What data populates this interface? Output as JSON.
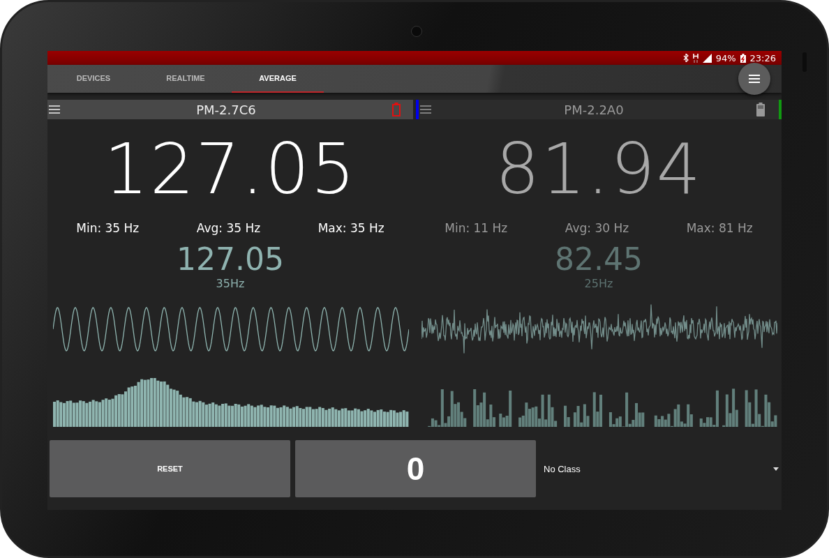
{
  "status_bar": {
    "battery": "94%",
    "time": "23:26"
  },
  "tabs": [
    {
      "label": "DEVICES",
      "selected": false
    },
    {
      "label": "REALTIME",
      "selected": false
    },
    {
      "label": "AVERAGE",
      "selected": true
    }
  ],
  "devices": [
    {
      "name": "PM-2.7C6",
      "battery_low": true,
      "active": true,
      "value": "127.05",
      "stats": [
        "Min: 35 Hz",
        "Avg: 35 Hz",
        "Max: 35 Hz"
      ],
      "peak_value": "127.05",
      "peak_freq": "35Hz",
      "waveform": {
        "kind": "sine"
      },
      "spectrum": {
        "kind": "peak"
      }
    },
    {
      "name": "PM-2.2A0",
      "battery_low": false,
      "active": false,
      "color": "#0000ee",
      "status": {
        "color": "#119911"
      },
      "value": "81.94",
      "stats": [
        "Min: 11 Hz",
        "Avg: 30 Hz",
        "Max: 81 Hz"
      ],
      "peak_value": "82.45",
      "peak_freq": "25Hz",
      "waveform": {
        "kind": "noise"
      },
      "spectrum": {
        "kind": "sparse"
      }
    }
  ],
  "controls": {
    "reset": "RESET",
    "counter": "0",
    "class_select": "No Class"
  }
}
